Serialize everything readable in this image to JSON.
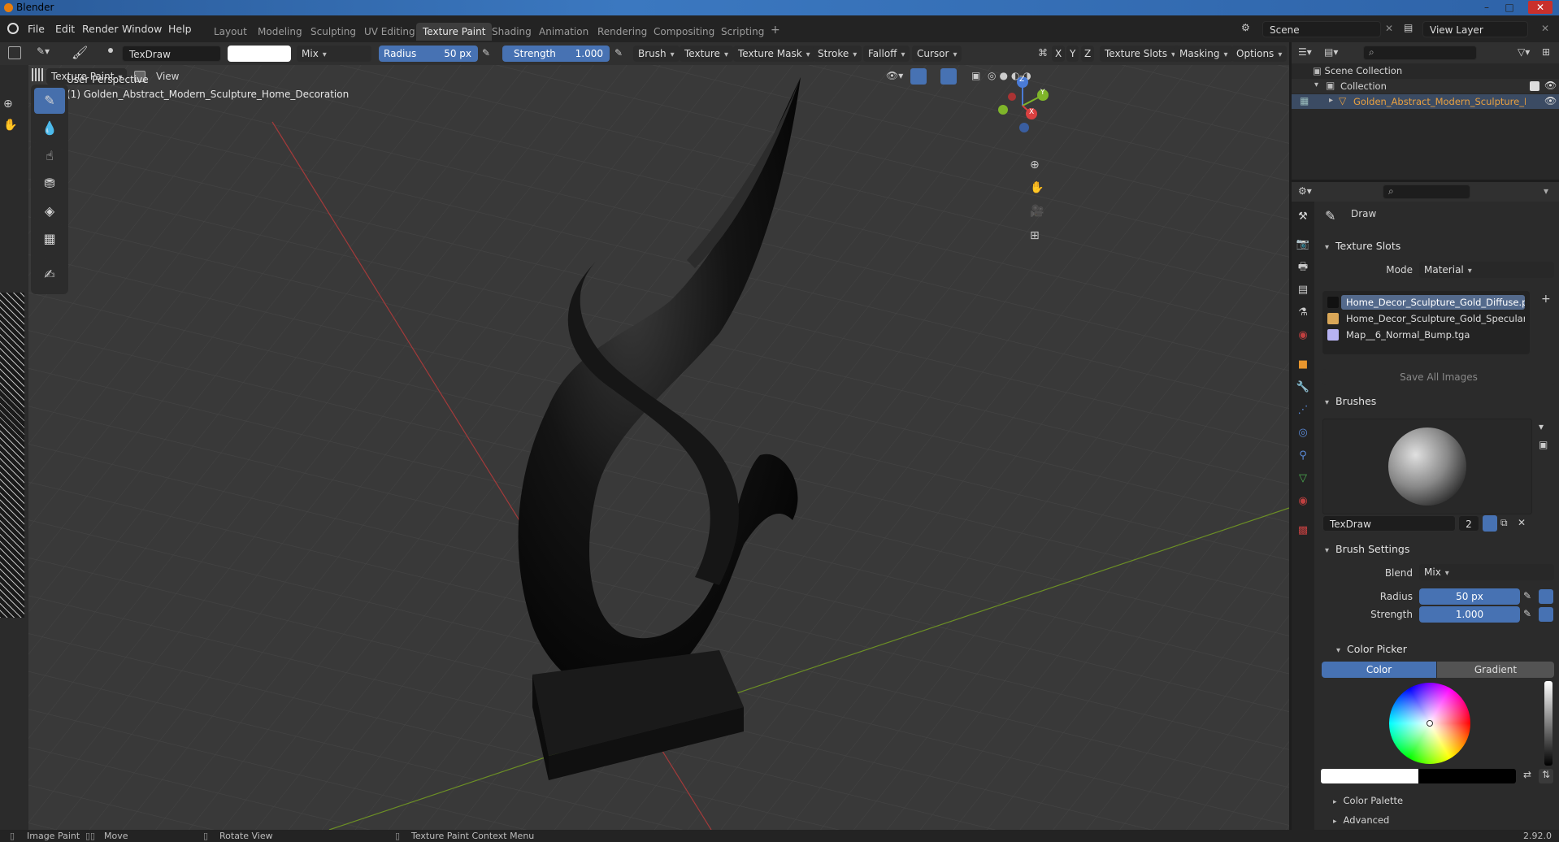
{
  "window": {
    "title": "Blender",
    "min": "–",
    "max": "□",
    "close": "✕"
  },
  "menu": [
    "File",
    "Edit",
    "Render",
    "Window",
    "Help"
  ],
  "workspaces": [
    "Layout",
    "Modeling",
    "Sculpting",
    "UV Editing",
    "Texture Paint",
    "Shading",
    "Animation",
    "Rendering",
    "Compositing",
    "Scripting"
  ],
  "active_workspace": "Texture Paint",
  "add_tab": "+",
  "scene": {
    "name": "Scene",
    "view_layer": "View Layer"
  },
  "tool_header": {
    "brush_name": "TexDraw",
    "blend": "Mix",
    "radius_label": "Radius",
    "radius_value": "50 px",
    "strength_label": "Strength",
    "strength_value": "1.000",
    "menus": [
      "Brush",
      "Texture",
      "Texture Mask",
      "Stroke",
      "Falloff",
      "Cursor"
    ],
    "axes": [
      "X",
      "Y",
      "Z"
    ],
    "texture_slots": "Texture Slots",
    "masking": "Masking",
    "options": "Options"
  },
  "viewport_header": {
    "mode": "Texture Paint",
    "view": "View"
  },
  "viewport": {
    "perspective": "User Perspective",
    "object_label": "(1) Golden_Abstract_Modern_Sculpture_Home_Decoration",
    "gizmo": {
      "x": "X",
      "y": "Y",
      "z": "Z"
    }
  },
  "outliner": {
    "scene_collection": "Scene Collection",
    "collection": "Collection",
    "object": "Golden_Abstract_Modern_Sculpture_Hor"
  },
  "properties": {
    "tool_name": "Draw",
    "texture_slots_title": "Texture Slots",
    "mode_label": "Mode",
    "mode_value": "Material",
    "images": [
      {
        "name": "Home_Decor_Sculpture_Gold_Diffuse.png",
        "color": "#111111"
      },
      {
        "name": "Home_Decor_Sculpture_Gold_Specular.png",
        "color": "#d9a758"
      },
      {
        "name": "Map__6_Normal_Bump.tga",
        "color": "#b7b3f2"
      }
    ],
    "save_all": "Save All Images",
    "brushes_title": "Brushes",
    "brush_name": "TexDraw",
    "brush_users": "2",
    "brush_settings_title": "Brush Settings",
    "blend_label": "Blend",
    "blend_value": "Mix",
    "radius_label": "Radius",
    "radius_value": "50 px",
    "strength_label": "Strength",
    "strength_value": "1.000",
    "color_picker_title": "Color Picker",
    "color_tab": "Color",
    "gradient_tab": "Gradient",
    "color_palette": "Color Palette",
    "advanced": "Advanced"
  },
  "status": {
    "image_paint": "Image Paint",
    "move": "Move",
    "rotate": "Rotate View",
    "context": "Texture Paint Context Menu",
    "version": "2.92.0"
  },
  "colors": {
    "accent": "#4772b3",
    "selected_row": "#546a8c",
    "object_orange": "#e8a040"
  }
}
